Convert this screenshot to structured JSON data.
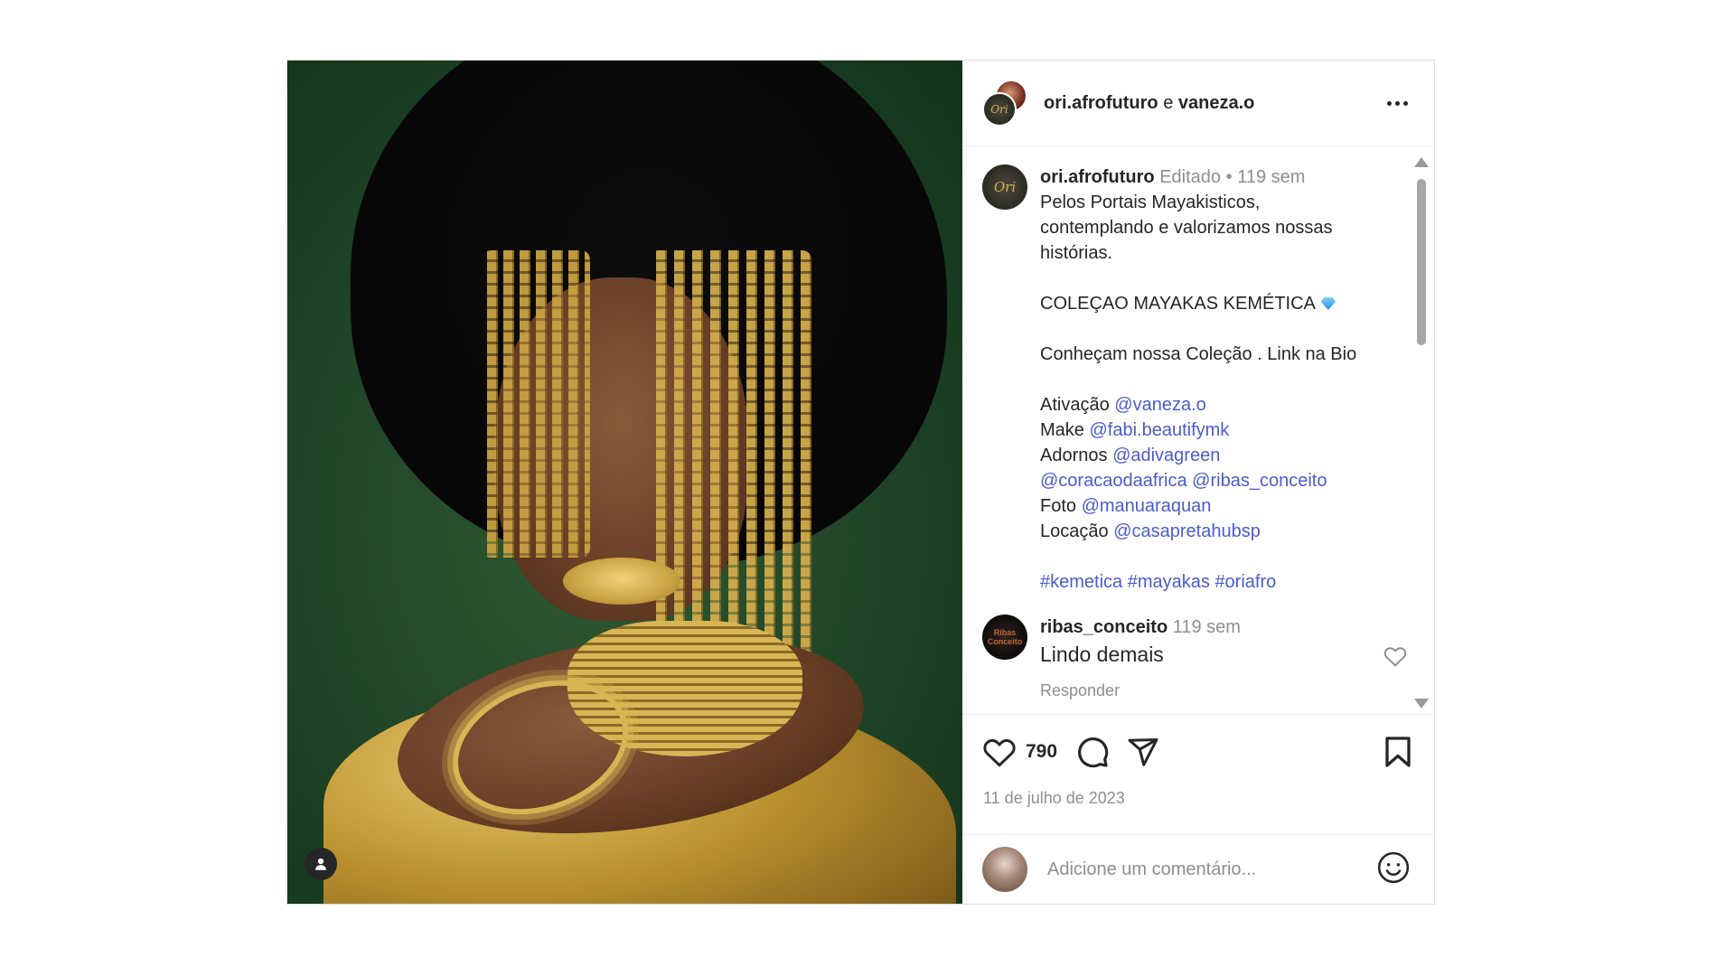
{
  "header": {
    "user1": "ori.afrofuturo",
    "conjunction": "e",
    "user2": "vaneza.o",
    "avatar_logo_text": "Ori"
  },
  "caption": {
    "username": "ori.afrofuturo",
    "edited": "Editado",
    "dot": "•",
    "time": "119 sem",
    "lines": [
      "Pelos Portais Mayakisticos,",
      "contemplando e valorizamos nossas",
      "histórias."
    ],
    "collection": "COLEÇAO MAYAKAS KEMÉTICA",
    "cta": "Conheçam nossa Coleção . Link na Bio",
    "credits": {
      "ativacao_label": "Ativação",
      "ativacao_mention": "@vaneza.o",
      "make_label": "Make",
      "make_mention": "@fabi.beautifymk",
      "adornos_label": "Adornos",
      "adornos_mention": "@adivagreen",
      "extra_mention_1": "@coracaodaafrica",
      "extra_mention_2": "@ribas_conceito",
      "foto_label": "Foto",
      "foto_mention": "@manuaraquan",
      "locacao_label": "Locação",
      "locacao_mention": "@casapretahubsp"
    },
    "hashtags": [
      "#kemetica",
      "#mayakas",
      "#oriafro"
    ]
  },
  "comment": {
    "username": "ribas_conceito",
    "time": "119 sem",
    "text": "Lindo demais",
    "reply": "Responder",
    "avatar_text": "Ribas Conceito"
  },
  "actions": {
    "likes": "790",
    "date": "11 de julho de 2023"
  },
  "composer": {
    "placeholder": "Adicione um comentário..."
  },
  "icons": {
    "tag": "person-tag-icon",
    "more": "more-options-icon",
    "like": "heart-icon",
    "comment": "comment-icon",
    "share": "share-icon",
    "save": "bookmark-icon",
    "emoji": "emoji-icon"
  }
}
